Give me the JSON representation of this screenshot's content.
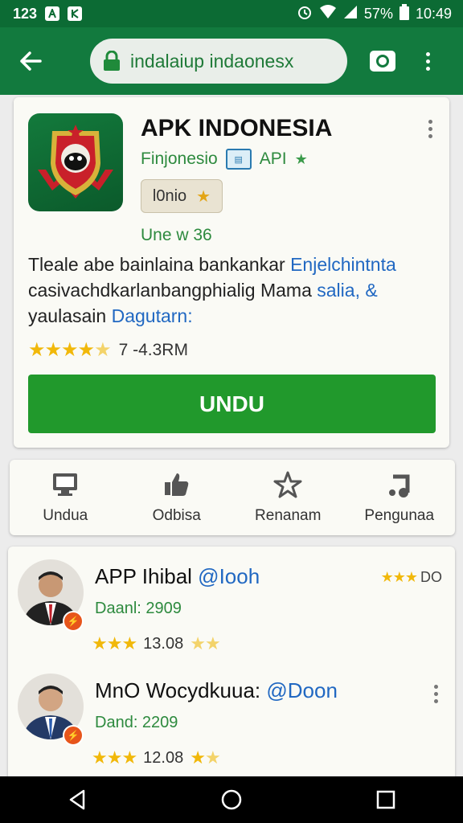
{
  "status_bar": {
    "time_left": "123",
    "battery_percent": "57%",
    "clock": "10:49",
    "left_icons": [
      "a-notification-icon",
      "k-notification-icon"
    ],
    "right_icons": [
      "alarm-icon",
      "wifi-icon",
      "signal-icon",
      "battery-icon"
    ]
  },
  "toolbar": {
    "url": "indalaiup indaonesx",
    "icons": [
      "back-arrow-icon",
      "lock-icon",
      "camera-icon",
      "more-vert-icon"
    ]
  },
  "app": {
    "title": "APK INDONESIA",
    "developer": "Finjonesio",
    "developer_tag": "API",
    "chip_label": "l0nio",
    "update_text": "Une w 36",
    "description_plain_1": "Tleale abe bainlaina bankankar ",
    "description_link_1": "Enjelchintnta",
    "description_plain_2": " casivachdkarlanbangphialig Mama ",
    "description_link_2": "salia, &",
    "description_plain_3": " yaulasain ",
    "description_link_3": "Dagutarn:",
    "rating_stars": 4.5,
    "rating_text": "7 -4.3RM",
    "install_label": "UNDU"
  },
  "tabs": [
    {
      "label": "Undua",
      "icon": "monitor-icon"
    },
    {
      "label": "Odbisa",
      "icon": "thumbs-up-icon"
    },
    {
      "label": "Renanam",
      "icon": "star-outline-icon"
    },
    {
      "label": "Pengunaa",
      "icon": "music-note-icon"
    }
  ],
  "reviews": [
    {
      "name": "APP Ihibal ",
      "handle": "@Iooh",
      "sub": "Daanl: 2909",
      "stars": 4.5,
      "score": "13.08",
      "side_rating": "DO",
      "side_stars": 3
    },
    {
      "name": "MnO Wocydkuua: ",
      "handle": "@Doon",
      "sub": "Dand: 2209",
      "stars": 4.5,
      "score": "12.08"
    }
  ],
  "nav_bar": {
    "icons": [
      "back-triangle-icon",
      "home-circle-icon",
      "recents-square-icon"
    ]
  },
  "colors": {
    "status_bar": "#0c6b34",
    "toolbar": "#127a3e",
    "install_button": "#21992c",
    "link": "#2168c2",
    "accent_green_text": "#2d8a3e",
    "star": "#f1b80a"
  }
}
